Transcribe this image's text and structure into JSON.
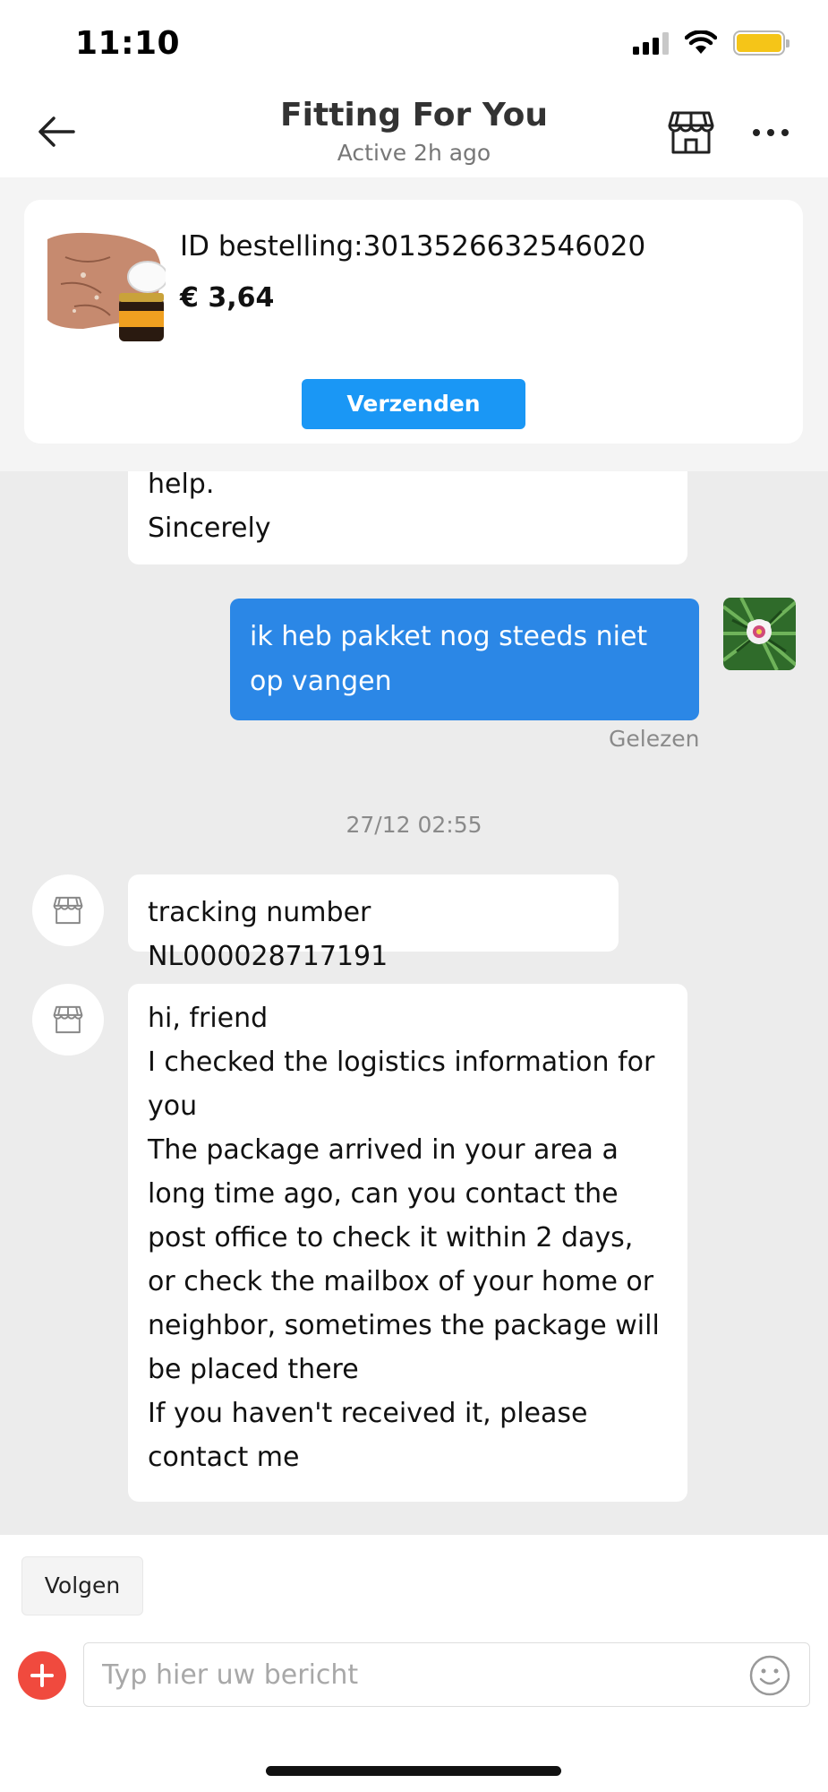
{
  "status_bar": {
    "time": "11:10",
    "battery_level": 1.0,
    "battery_color": "#f5c518"
  },
  "header": {
    "title": "Fitting For You",
    "subtitle": "Active 2h ago",
    "back_icon": "arrow-left-icon",
    "store_icon": "storefront-icon",
    "more_icon": "more-dots-icon"
  },
  "order": {
    "id_label": "ID bestelling:3013526632546020",
    "price": "€ 3,64",
    "send_button_label": "Verzenden",
    "accent_color": "#1a97f5"
  },
  "messages": {
    "partial_text": "help.\nSincerely",
    "mine_text": "ik heb pakket nog steeds niet op vangen",
    "mine_color": "#2b87e6",
    "read_status": "Gelezen",
    "timestamp": "27/12 02:55",
    "tracking_text": "tracking number NL000028717191",
    "long_text": "hi, friend\nI checked the logistics information for you\nThe package arrived in your area a long time ago, can you contact the post office to check it within 2 days, or check the mailbox of your home or neighbor, sometimes the package will be placed there\nIf you haven't received it, please contact me"
  },
  "bottom_bar": {
    "follow_label": "Volgen",
    "input_placeholder": "Typ hier uw bericht",
    "plus_icon": "plus-circle-icon",
    "emoji_icon": "smiley-icon",
    "plus_color": "#f04a3e"
  }
}
